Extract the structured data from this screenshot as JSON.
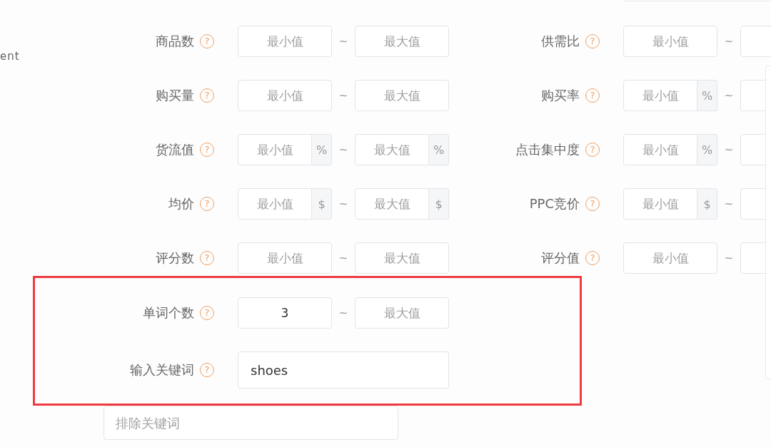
{
  "sidebar": {
    "text": "ent"
  },
  "filter_rows": [
    {
      "left": {
        "kind": "range",
        "label": "商品数",
        "help": "?",
        "min": {
          "placeholder": "最小值"
        },
        "separator": "~",
        "max": {
          "placeholder": "最大值"
        }
      },
      "right": {
        "kind": "range",
        "label": "供需比",
        "help": "?",
        "min": {
          "placeholder": "最小值"
        },
        "separator": "~"
      }
    },
    {
      "left": {
        "kind": "range",
        "label": "购买量",
        "help": "?",
        "min": {
          "placeholder": "最小值"
        },
        "separator": "~",
        "max": {
          "placeholder": "最大值"
        }
      },
      "right": {
        "kind": "range",
        "label": "购买率",
        "help": "?",
        "min": {
          "placeholder": "最小值",
          "unit": "%"
        },
        "separator": "~"
      }
    },
    {
      "left": {
        "kind": "range",
        "label": "货流值",
        "help": "?",
        "min": {
          "placeholder": "最小值",
          "unit": "%"
        },
        "separator": "~",
        "max": {
          "placeholder": "最大值",
          "unit": "%"
        }
      },
      "right": {
        "kind": "range",
        "label": "点击集中度",
        "help": "?",
        "min": {
          "placeholder": "最小值",
          "unit": "%"
        },
        "separator": "~"
      }
    },
    {
      "left": {
        "kind": "range",
        "label": "均价",
        "help": "?",
        "min": {
          "placeholder": "最小值",
          "unit": "$"
        },
        "separator": "~",
        "max": {
          "placeholder": "最大值",
          "unit": "$"
        }
      },
      "right": {
        "kind": "range",
        "label": "PPC竞价",
        "help": "?",
        "min": {
          "placeholder": "最小值",
          "unit": "$"
        },
        "separator": "~"
      }
    },
    {
      "left": {
        "kind": "range",
        "label": "评分数",
        "help": "?",
        "min": {
          "placeholder": "最小值"
        },
        "separator": "~",
        "max": {
          "placeholder": "最大值"
        }
      },
      "right": {
        "kind": "range",
        "label": "评分值",
        "help": "?",
        "min": {
          "placeholder": "最小值"
        },
        "separator": "~"
      }
    }
  ],
  "highlighted_filters": [
    {
      "kind": "range",
      "label": "单词个数",
      "help": "?",
      "min": {
        "value": "3"
      },
      "separator": "~",
      "max": {
        "placeholder": "最大值"
      }
    },
    {
      "kind": "text",
      "label": "输入关键词",
      "help": "?",
      "value": "shoes"
    }
  ],
  "exclude_keywords": {
    "placeholder": "排除关键词"
  }
}
